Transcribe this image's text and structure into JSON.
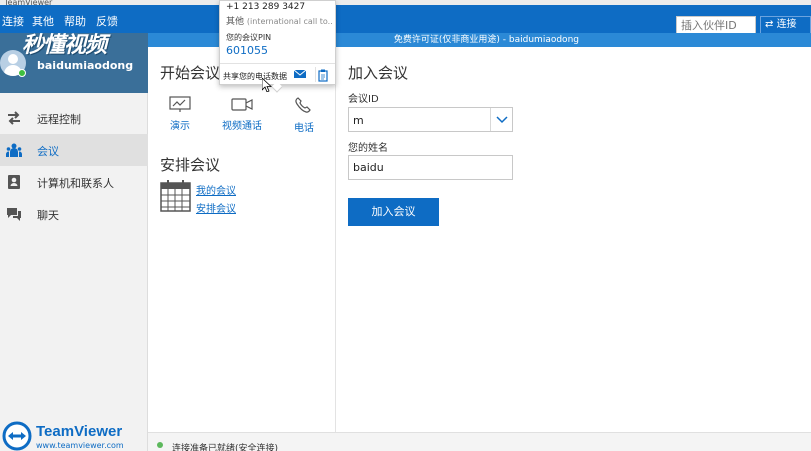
{
  "window": {
    "title": "TeamViewer"
  },
  "menu": {
    "items": [
      "连接",
      "其他",
      "帮助",
      "反馈"
    ]
  },
  "partner": {
    "placeholder": "插入伙伴ID",
    "connect_label": "连接"
  },
  "license_text": "免费许可证(仅非商业用途) - baidumiaodong",
  "watermark_text": "秒懂视频",
  "profile": {
    "username": "baidumiaodong",
    "status": "online"
  },
  "sidebar": {
    "items": [
      {
        "label": "远程控制",
        "icon": "arrows-icon",
        "active": false
      },
      {
        "label": "会议",
        "icon": "people-icon",
        "active": true
      },
      {
        "label": "计算机和联系人",
        "icon": "contacts-icon",
        "active": false
      },
      {
        "label": "聊天",
        "icon": "chat-icon",
        "active": false
      }
    ]
  },
  "brand": {
    "name": "TeamViewer",
    "url": "www.teamviewer.com"
  },
  "start_meeting": {
    "title": "开始会议",
    "buttons": [
      {
        "label": "演示",
        "icon": "presentation-icon"
      },
      {
        "label": "视频通话",
        "icon": "video-camera-icon"
      },
      {
        "label": "电话",
        "icon": "phone-icon"
      }
    ]
  },
  "schedule_meeting": {
    "title": "安排会议",
    "links": [
      "我的会议",
      "安排会议"
    ]
  },
  "join_meeting": {
    "title": "加入会议",
    "meeting_id_label": "会议ID",
    "meeting_id_value": "m",
    "name_label": "您的姓名",
    "name_value": "baidu",
    "join_label": "加入会议"
  },
  "phone_popup": {
    "phone_number": "+1 213 289 3427",
    "country_label": "其他",
    "country_note": "(international call to...",
    "pin_label": "您的会议PIN",
    "pin": "601055",
    "share_label": "共享您的电话数据"
  },
  "status": {
    "text": "连接准备已就绪(安全连接)"
  },
  "colors": {
    "accent": "#0e6cc4",
    "status_green": "#5cb85c"
  }
}
